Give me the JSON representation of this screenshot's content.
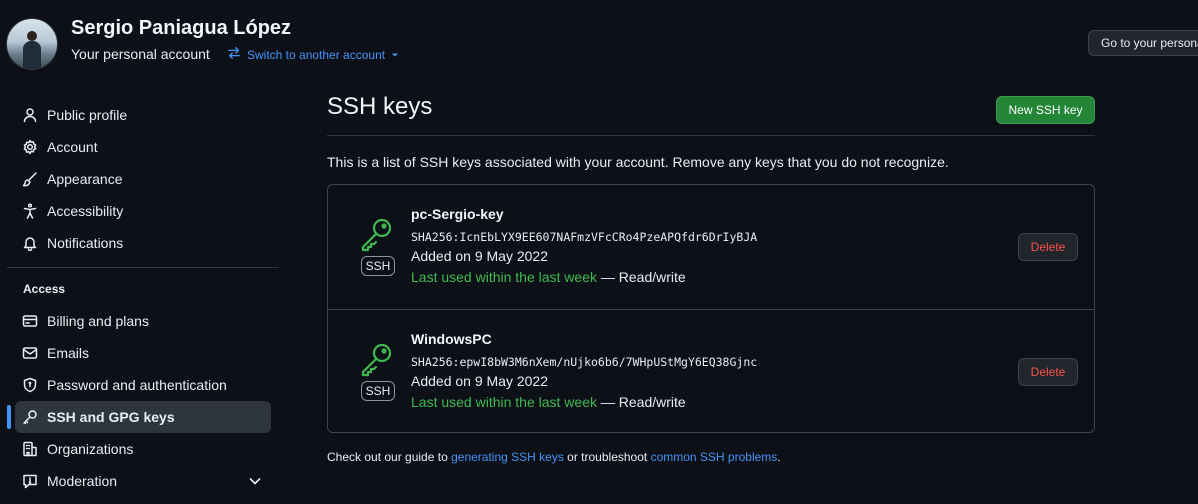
{
  "header": {
    "user_name": "Sergio Paniagua López",
    "account_label": "Your personal account",
    "switch_label": "Switch to another account",
    "goto_button": "Go to your personal profile"
  },
  "sidebar": {
    "items": [
      {
        "label": "Public profile",
        "icon": "person-icon"
      },
      {
        "label": "Account",
        "icon": "gear-icon"
      },
      {
        "label": "Appearance",
        "icon": "paintbrush-icon"
      },
      {
        "label": "Accessibility",
        "icon": "accessibility-icon"
      },
      {
        "label": "Notifications",
        "icon": "bell-icon"
      }
    ],
    "access_heading": "Access",
    "access_items": [
      {
        "label": "Billing and plans",
        "icon": "credit-card-icon"
      },
      {
        "label": "Emails",
        "icon": "mail-icon"
      },
      {
        "label": "Password and authentication",
        "icon": "shield-lock-icon"
      },
      {
        "label": "SSH and GPG keys",
        "icon": "key-icon",
        "active": true
      },
      {
        "label": "Organizations",
        "icon": "organization-icon"
      },
      {
        "label": "Moderation",
        "icon": "report-icon"
      }
    ]
  },
  "main": {
    "title": "SSH keys",
    "new_key_button": "New SSH key",
    "intro": "This is a list of SSH keys associated with your account. Remove any keys that you do not recognize.",
    "keys": [
      {
        "badge": "SSH",
        "title": "pc-Sergio-key",
        "fingerprint": "SHA256:IcnEbLYX9EE607NAFmzVFcCRo4PzeAPQfdr6DrIyBJA",
        "added": "Added on 9 May 2022",
        "last_used": "Last used within the last week",
        "access": "— Read/write",
        "delete_label": "Delete"
      },
      {
        "badge": "SSH",
        "title": "WindowsPC",
        "fingerprint": "SHA256:epwI8bW3M6nXem/nUjko6b6/7WHpUStMgY6EQ38Gjnc",
        "added": "Added on 9 May 2022",
        "last_used": "Last used within the last week",
        "access": "— Read/write",
        "delete_label": "Delete"
      }
    ],
    "footer": {
      "prefix": "Check out our guide to",
      "link1": "generating SSH keys",
      "middle": "or troubleshoot",
      "link2": "common SSH problems",
      "suffix": "."
    }
  },
  "colors": {
    "background": "#0d1117",
    "accent_blue": "#4493f8",
    "success_green": "#3fb950",
    "primary_button": "#238636",
    "danger_red": "#f85149"
  }
}
